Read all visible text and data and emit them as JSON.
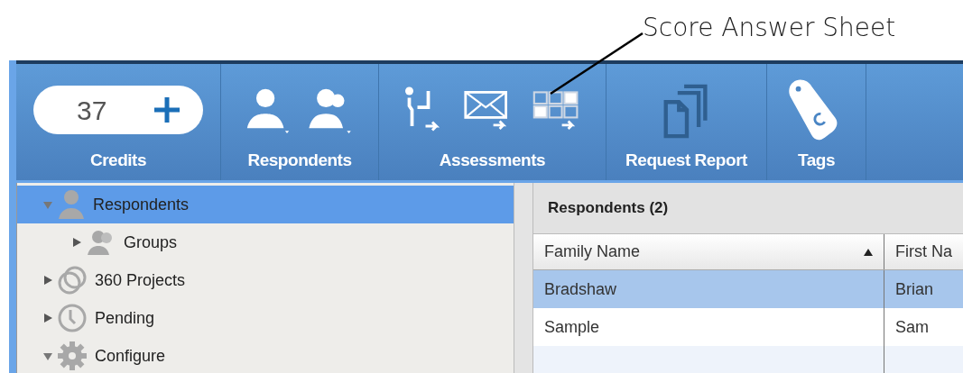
{
  "annotation": {
    "text": "Score Answer Sheet"
  },
  "toolbar": {
    "groups": [
      {
        "kind": "credits",
        "value": "37",
        "label": "Credits"
      },
      {
        "kind": "respondents",
        "label": "Respondents"
      },
      {
        "kind": "assessments",
        "label": "Assessments"
      },
      {
        "kind": "report",
        "label": "Request Report"
      },
      {
        "kind": "tags",
        "label": "Tags"
      }
    ]
  },
  "tree": {
    "items": [
      {
        "kind": "person",
        "label": "Respondents",
        "expanded": true,
        "selected": true,
        "children": [
          {
            "kind": "group",
            "label": "Groups",
            "expanded": false,
            "selected": false
          }
        ]
      },
      {
        "kind": "circles",
        "label": "360 Projects",
        "expanded": false,
        "selected": false
      },
      {
        "kind": "clock",
        "label": "Pending",
        "expanded": false,
        "selected": false
      },
      {
        "kind": "gear",
        "label": "Configure",
        "expanded": true,
        "selected": false
      }
    ]
  },
  "table": {
    "title": "Respondents (2)",
    "columns": [
      {
        "label": "Family Name",
        "sorted": true
      },
      {
        "label": "First Na",
        "sorted": false
      }
    ],
    "rows": [
      {
        "cells": [
          "Bradshaw",
          "Brian"
        ],
        "selected": true
      },
      {
        "cells": [
          "Sample",
          "Sam"
        ],
        "selected": false
      }
    ]
  }
}
